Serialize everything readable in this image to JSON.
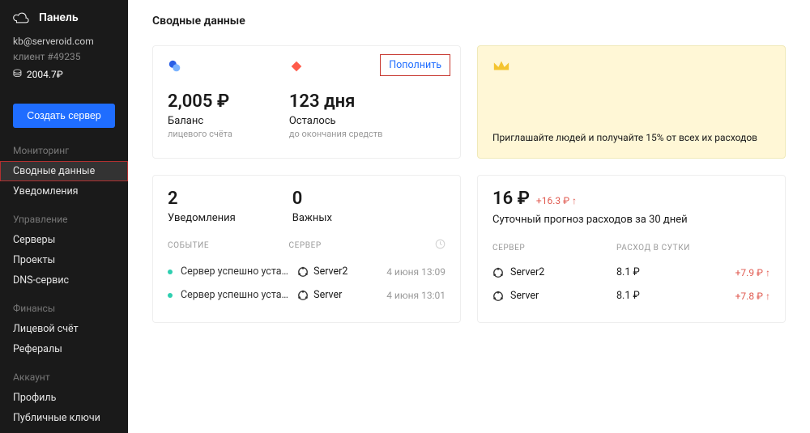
{
  "sidebar": {
    "title": "Панель",
    "email": "kb@serveroid.com",
    "client_label": "клиент #49235",
    "balance": "2004.7₽",
    "create_server": "Создать сервер",
    "sections": [
      {
        "title": "Мониторинг",
        "items": [
          "Сводные данные",
          "Уведомления"
        ],
        "active_index": 0
      },
      {
        "title": "Управление",
        "items": [
          "Серверы",
          "Проекты",
          "DNS-сервис"
        ]
      },
      {
        "title": "Финансы",
        "items": [
          "Лицевой счёт",
          "Рефералы"
        ]
      },
      {
        "title": "Аккаунт",
        "items": [
          "Профиль",
          "Публичные ключи"
        ]
      }
    ]
  },
  "page": {
    "title": "Сводные данные"
  },
  "balance_card": {
    "topup": "Пополнить",
    "balance_value": "2,005 ₽",
    "balance_label": "Баланс",
    "balance_sub": "лицевого счёта",
    "days_value": "123 дня",
    "days_label": "Осталось",
    "days_sub": "до окончания средств"
  },
  "promo": {
    "text": "Приглашайте людей и получайте 15% от всех их расходов"
  },
  "notifications": {
    "count1": "2",
    "label1": "Уведомления",
    "count2": "0",
    "label2": "Важных",
    "col_event": "СОБЫТИЕ",
    "col_server": "СЕРВЕР",
    "rows": [
      {
        "event": "Сервер успешно устано...",
        "server": "Server2",
        "time": "4 июня 13:09"
      },
      {
        "event": "Сервер успешно устано...",
        "server": "Server",
        "time": "4 июня 13:01"
      }
    ]
  },
  "forecast": {
    "amount": "16 ₽",
    "delta": "+16.3 ₽ ↑",
    "sub": "Суточный прогноз расходов за 30 дней",
    "col_server": "СЕРВЕР",
    "col_rate": "РАСХОД В СУТКИ",
    "rows": [
      {
        "server": "Server2",
        "rate": "8.1 ₽",
        "delta": "+7.9 ₽ ↑"
      },
      {
        "server": "Server",
        "rate": "8.1 ₽",
        "delta": "+7.8 ₽ ↑"
      }
    ]
  }
}
